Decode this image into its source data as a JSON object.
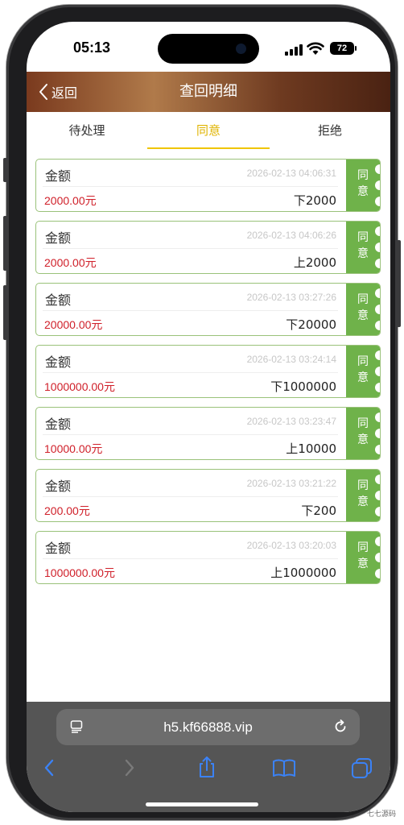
{
  "status_bar": {
    "time": "05:13",
    "battery": "72"
  },
  "nav": {
    "back_label": "返回",
    "title": "查回明细"
  },
  "tabs": [
    {
      "label": "待处理",
      "active": false
    },
    {
      "label": "同意",
      "active": true
    },
    {
      "label": "拒绝",
      "active": false
    }
  ],
  "records": [
    {
      "label": "金额",
      "time": "2026-02-13 04:06:31",
      "amount": "2000.00元",
      "note": "下2000",
      "status": "同意"
    },
    {
      "label": "金额",
      "time": "2026-02-13 04:06:26",
      "amount": "2000.00元",
      "note": "上2000",
      "status": "同意"
    },
    {
      "label": "金额",
      "time": "2026-02-13 03:27:26",
      "amount": "20000.00元",
      "note": "下20000",
      "status": "同意"
    },
    {
      "label": "金额",
      "time": "2026-02-13 03:24:14",
      "amount": "1000000.00元",
      "note": "下1000000",
      "status": "同意"
    },
    {
      "label": "金额",
      "time": "2026-02-13 03:23:47",
      "amount": "10000.00元",
      "note": "上10000",
      "status": "同意"
    },
    {
      "label": "金额",
      "time": "2026-02-13 03:21:22",
      "amount": "200.00元",
      "note": "下200",
      "status": "同意"
    },
    {
      "label": "金额",
      "time": "2026-02-13 03:20:03",
      "amount": "1000000.00元",
      "note": "上1000000",
      "status": "同意"
    }
  ],
  "browser": {
    "url": "h5.kf66888.vip"
  },
  "watermark": "七七源码",
  "colors": {
    "accent_tab": "#e0b400",
    "stamp_green": "#6fb24a",
    "amount_red": "#d0202a",
    "card_border": "#9ac27a",
    "ios_blue": "#3b82f6"
  },
  "icons": {
    "back": "chevron-left-icon",
    "page": "page-menu-icon",
    "reload": "reload-icon",
    "nav_back": "chevron-left-icon",
    "nav_forward": "chevron-right-icon",
    "share": "share-icon",
    "bookmarks": "book-icon",
    "tabs": "tabs-icon"
  }
}
